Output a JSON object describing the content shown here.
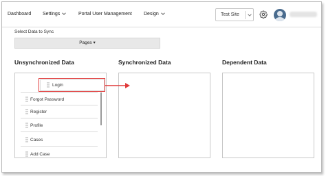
{
  "nav": {
    "items": [
      {
        "label": "Dashboard",
        "has_dropdown": false
      },
      {
        "label": "Settings",
        "has_dropdown": true
      },
      {
        "label": "Portal User Management",
        "has_dropdown": false
      },
      {
        "label": "Design",
        "has_dropdown": true
      }
    ],
    "site_select": {
      "value": "Test Site",
      "icon": "chevron-down-icon"
    },
    "settings_icon": "gear-icon",
    "avatar_icon": "user-avatar"
  },
  "content": {
    "select_label": "Select Data to Sync",
    "pages_button": "Pages ▾"
  },
  "columns": {
    "unsync_title": "Unsynchronized Data",
    "sync_title": "Synchronized Data",
    "dep_title": "Dependent Data"
  },
  "unsync_items": [
    {
      "label": "Forgot Password"
    },
    {
      "label": "Register"
    },
    {
      "label": "Profile"
    },
    {
      "label": "Cases"
    },
    {
      "label": "Add Case"
    }
  ],
  "dragging_item": {
    "label": "Login"
  },
  "colors": {
    "highlight": "#e03a3a",
    "border": "#c8c8c8",
    "button_bg": "#e8e8e8"
  }
}
